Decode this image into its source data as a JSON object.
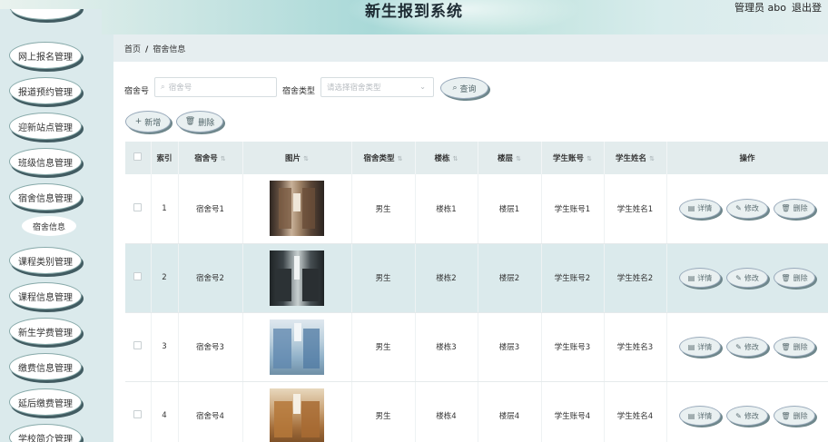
{
  "header": {
    "title": "新生报到系统",
    "admin": "管理员 abo",
    "logout": "退出登"
  },
  "sidebar": {
    "items": [
      {
        "label": "网上报名管理"
      },
      {
        "label": "报道预约管理"
      },
      {
        "label": "迎新站点管理"
      },
      {
        "label": "班级信息管理"
      },
      {
        "label": "宿舍信息管理"
      },
      {
        "label": "宿舍信息"
      },
      {
        "label": "课程类别管理"
      },
      {
        "label": "课程信息管理"
      },
      {
        "label": "新生学费管理"
      },
      {
        "label": "缴费信息管理"
      },
      {
        "label": "延后缴费管理"
      },
      {
        "label": "学校简介管理"
      }
    ]
  },
  "breadcrumb": {
    "home": "首页",
    "sep": "/",
    "current": "宿舍信息"
  },
  "search": {
    "room_label": "宿舍号",
    "room_placeholder": "宿舍号",
    "type_label": "宿舍类型",
    "type_placeholder": "请选择宿舍类型",
    "query": "查询"
  },
  "actions": {
    "add": "新增",
    "delete": "删除"
  },
  "table": {
    "headers": {
      "index": "索引",
      "room": "宿舍号",
      "image": "图片",
      "type": "宿舍类型",
      "building": "楼栋",
      "floor": "楼层",
      "account": "学生账号",
      "name": "学生姓名",
      "ops": "操作"
    },
    "op_labels": {
      "detail": "详情",
      "edit": "修改",
      "delete": "删除"
    },
    "rows": [
      {
        "index": "1",
        "room": "宿舍号1",
        "type": "男生",
        "building": "楼栋1",
        "floor": "楼层1",
        "account": "学生账号1",
        "name": "学生姓名1"
      },
      {
        "index": "2",
        "room": "宿舍号2",
        "type": "男生",
        "building": "楼栋2",
        "floor": "楼层2",
        "account": "学生账号2",
        "name": "学生姓名2"
      },
      {
        "index": "3",
        "room": "宿舍号3",
        "type": "男生",
        "building": "楼栋3",
        "floor": "楼层3",
        "account": "学生账号3",
        "name": "学生姓名3"
      },
      {
        "index": "4",
        "room": "宿舍号4",
        "type": "男生",
        "building": "楼栋4",
        "floor": "楼层4",
        "account": "学生账号4",
        "name": "学生姓名4"
      }
    ]
  },
  "icons": {
    "search": "search-icon",
    "add": "plus-icon",
    "delete": "trash-icon",
    "detail": "document-icon",
    "edit": "pencil-icon",
    "select": "chevron-down-icon",
    "sort": "sort-icon"
  }
}
